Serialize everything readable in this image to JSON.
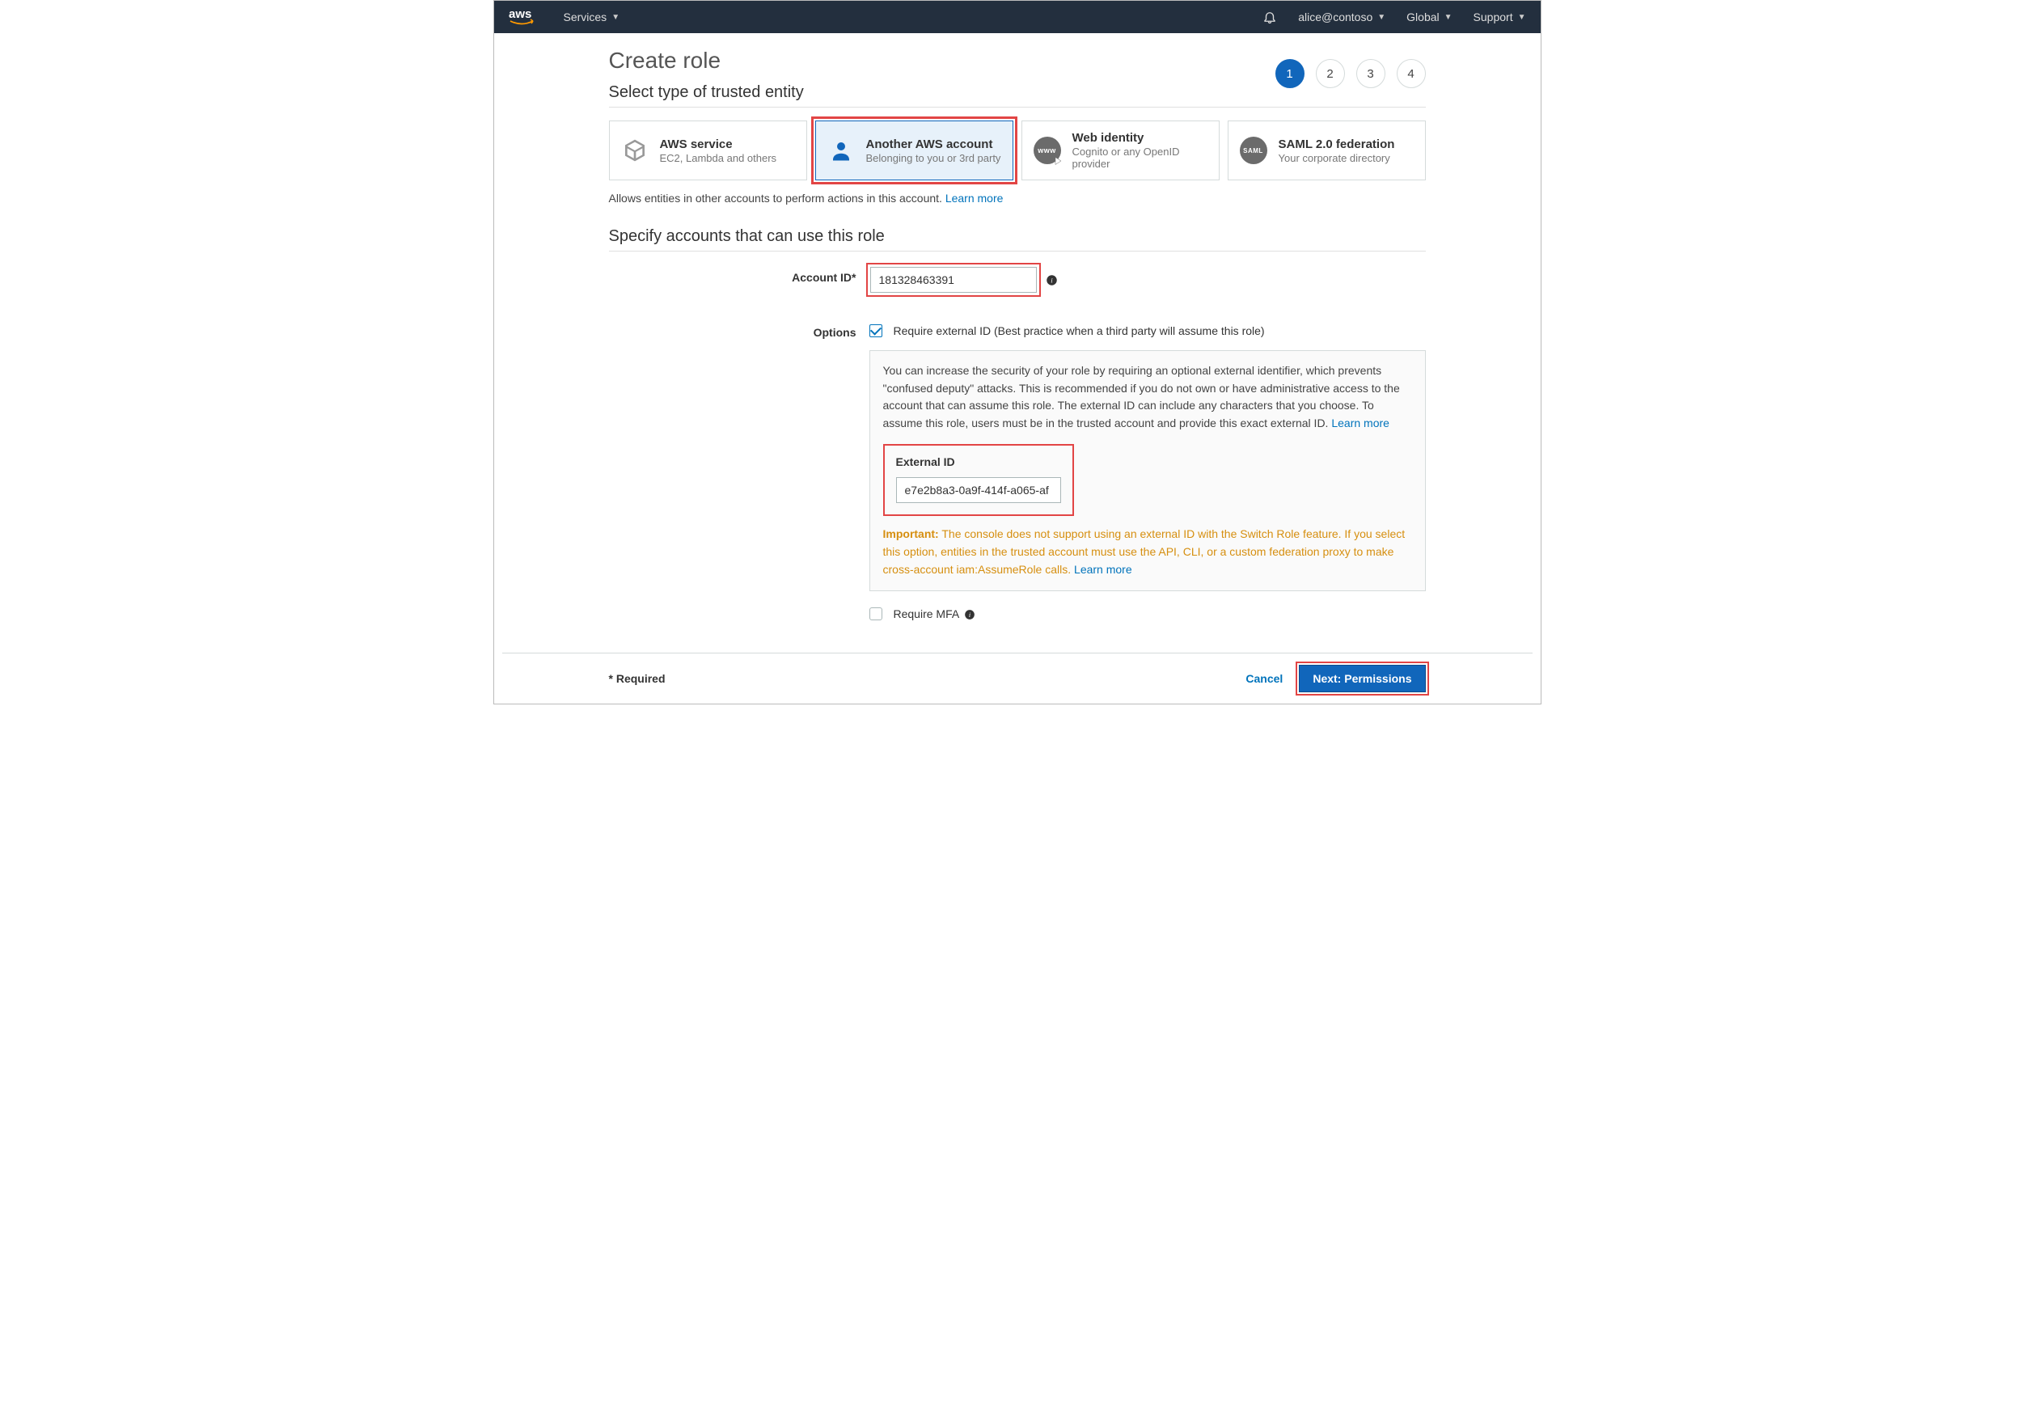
{
  "topnav": {
    "services": "Services",
    "user": "alice@contoso",
    "region": "Global",
    "support": "Support"
  },
  "pageTitle": "Create role",
  "steps": [
    "1",
    "2",
    "3",
    "4"
  ],
  "activeStep": 0,
  "section1": {
    "title": "Select type of trusted entity"
  },
  "entities": [
    {
      "title": "AWS service",
      "sub": "EC2, Lambda and others"
    },
    {
      "title": "Another AWS account",
      "sub": "Belonging to you or 3rd party"
    },
    {
      "title": "Web identity",
      "sub": "Cognito or any OpenID provider"
    },
    {
      "title": "SAML 2.0 federation",
      "sub": "Your corporate directory"
    }
  ],
  "entityIconText": {
    "web": "www",
    "saml": "SAML"
  },
  "entityDesc": "Allows entities in other accounts to perform actions in this account. ",
  "learnMore": "Learn more",
  "section2": {
    "title": "Specify accounts that can use this role"
  },
  "form": {
    "accountIdLabel": "Account ID*",
    "accountIdValue": "181328463391",
    "optionsLabel": "Options",
    "requireExternalIdLabel": "Require external ID (Best practice when a third party will assume this role)",
    "infoBoxText": "You can increase the security of your role by requiring an optional external identifier, which prevents \"confused deputy\" attacks. This is recommended if you do not own or have administrative access to the account that can assume this role. The external ID can include any characters that you choose. To assume this role, users must be in the trusted account and provide this exact external ID. ",
    "externalIdLabel": "External ID",
    "externalIdValue": "e7e2b8a3-0a9f-414f-a065-af",
    "importantLabel": "Important:",
    "importantText": " The console does not support using an external ID with the Switch Role feature. If you select this option, entities in the trusted account must use the API, CLI, or a custom federation proxy to make cross-account iam:AssumeRole calls. ",
    "requireMfaLabel": "Require MFA"
  },
  "footer": {
    "required": "* Required",
    "cancel": "Cancel",
    "next": "Next: Permissions"
  }
}
